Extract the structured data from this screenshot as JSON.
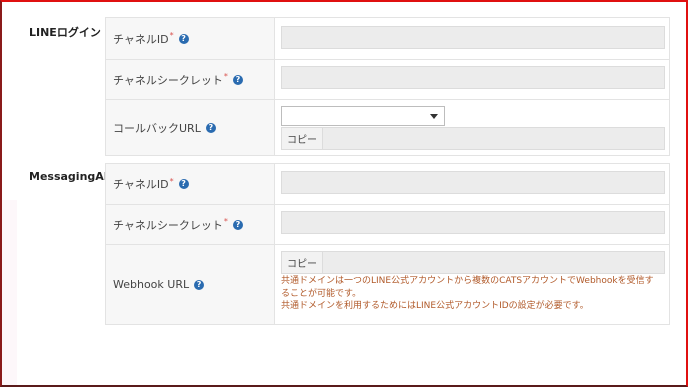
{
  "line_login": {
    "section_title": "LINEログイン",
    "channel_id_label": "チャネルID",
    "channel_secret_label": "チャネルシークレット",
    "callback_url_label": "コールバックURL",
    "required_mark": "*",
    "help_glyph": "?",
    "callback_select_value": "",
    "copy_label": "コピー"
  },
  "messaging_api": {
    "section_title": "MessagingAPI",
    "channel_id_label": "チャネルID",
    "channel_secret_label": "チャネルシークレット",
    "webhook_url_label": "Webhook URL",
    "required_mark": "*",
    "help_glyph": "?",
    "copy_label": "コピー",
    "note_line1": "共通ドメインは一つのLINE公式アカウントから複数のCATSアカウントでWebhookを受信す",
    "note_line2": "ることが可能です。",
    "note_line3": "共通ドメインを利用するためにはLINE公式アカウントIDの設定が必要です。"
  },
  "colors": {
    "frame": "#e01010",
    "help_icon": "#2a6bb0",
    "required": "#d9534f",
    "note_text": "#b15a2a"
  }
}
